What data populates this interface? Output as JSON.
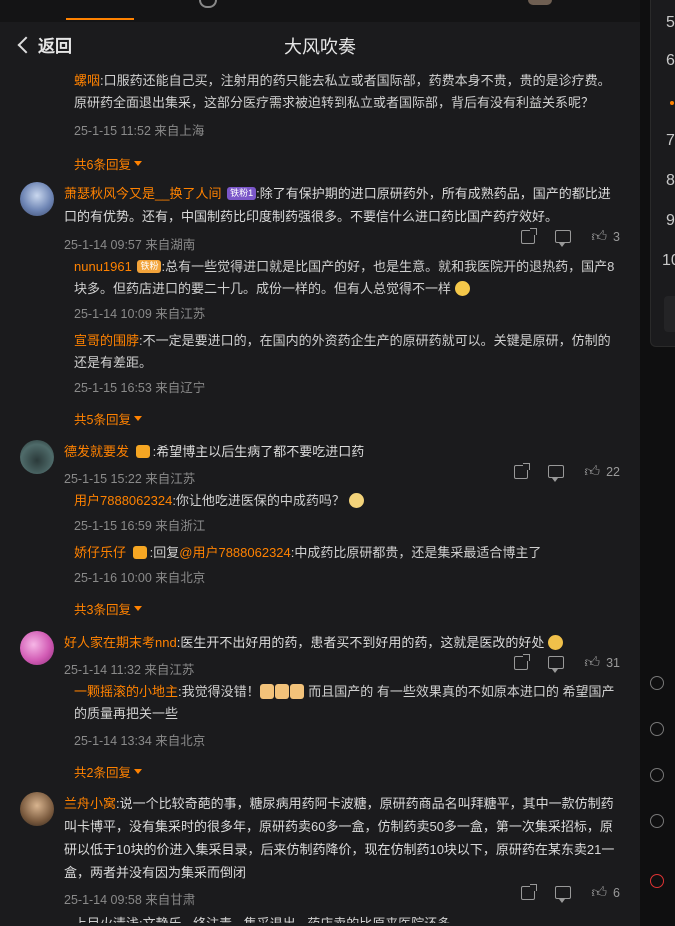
{
  "header": {
    "back_label": "返回",
    "title": "大风吹奏"
  },
  "top_section": {
    "reply": {
      "user": "螺咽",
      "text": ":口服药还能自己买，注射用的药只能去私立或者国际部，药费本身不贵，贵的是诊疗费。原研药全面退出集采，这部分医疗需求被迫转到私立或者国际部，背后有没有利益关系呢？",
      "meta": "25-1-15 11:52 来自上海"
    },
    "more_label": "共6条回复"
  },
  "comments": [
    {
      "user": "萧瑟秋风今又是__换了人间",
      "badge": "铁粉1",
      "text": ":除了有保护期的进口原研药外，所有成熟药品，国产的都比进口的有优势。还有，中国制药比印度制药强很多。不要信什么进口药比国产药疗效好。",
      "meta": "25-1-14 09:57 来自湖南",
      "likes": "3",
      "replies": [
        {
          "user": "nunu1961",
          "badge": "铁粉",
          "text": ":总有一些觉得进口就是比国产的好，也是生意。就和我医院开的退热药，国产8块多。但药店进口的要二十几。成份一样的。但有人总觉得不一样",
          "meta": "25-1-14 10:09 来自江苏"
        },
        {
          "user": "宣哥的围脖",
          "text": ":不一定是要进口的，在国内的外资药企生产的原研药就可以。关键是原研，仿制的还是有差距。",
          "meta": "25-1-15 16:53 来自辽宁"
        }
      ],
      "more_label": "共5条回复"
    },
    {
      "user": "德发就要发",
      "text": ":希望博主以后生病了都不要吃进口药",
      "meta": "25-1-15 15:22 来自江苏",
      "likes": "22",
      "replies": [
        {
          "user": "用户7888062324",
          "text": ":你让他吃进医保的中成药吗？",
          "meta": "25-1-15 16:59 来自浙江"
        },
        {
          "user": "娇仔乐仔",
          "mention": "@用户7888062324",
          "prefix": ":回复",
          "text": ":中成药比原研都贵，还是集采最适合博主了",
          "meta": "25-1-16 10:00 来自北京"
        }
      ],
      "more_label": "共3条回复"
    },
    {
      "user": "好人家在期末考nnd",
      "text": ":医生开不出好用的药，患者买不到好用的药，这就是医改的好处",
      "meta": "25-1-14 11:32 来自江苏",
      "likes": "31",
      "replies": [
        {
          "user": "一颗摇滚的小地主",
          "text_a": ":我觉得没错！",
          "text_b": " 而且国产的 有一些效果真的不如原本进口的  希望国产的质量再把关一些",
          "meta": "25-1-14 13:34 来自北京"
        }
      ],
      "more_label": "共2条回复"
    },
    {
      "user": "兰舟小窝",
      "text": ":说一个比较奇葩的事，糖尿病用药阿卡波糖，原研药商品名叫拜糖平，其中一款仿制药叫卡博平，没有集采时的很多年，原研药卖60多一盒，仿制药卖50多一盒，第一次集采招标，原研以低于10块的价进入集采目录，后来仿制药降价，现在仿制药10块以下，原研药在某东卖21一盒，两者并没有因为集采而倒闭",
      "meta": "25-1-14 09:58 来自甘肃",
      "likes": "6",
      "partial_reply": "上目火清浅:文静乐 · 终注毒 · 集采退出 · 药店卖的比原来医院还多"
    }
  ],
  "right_rail": {
    "numbers": [
      "5",
      "6",
      "7",
      "8",
      "9",
      "10"
    ]
  },
  "colors": {
    "accent": "#ff8200",
    "background": "#1b1b1d",
    "meta": "#8a8a8a"
  }
}
